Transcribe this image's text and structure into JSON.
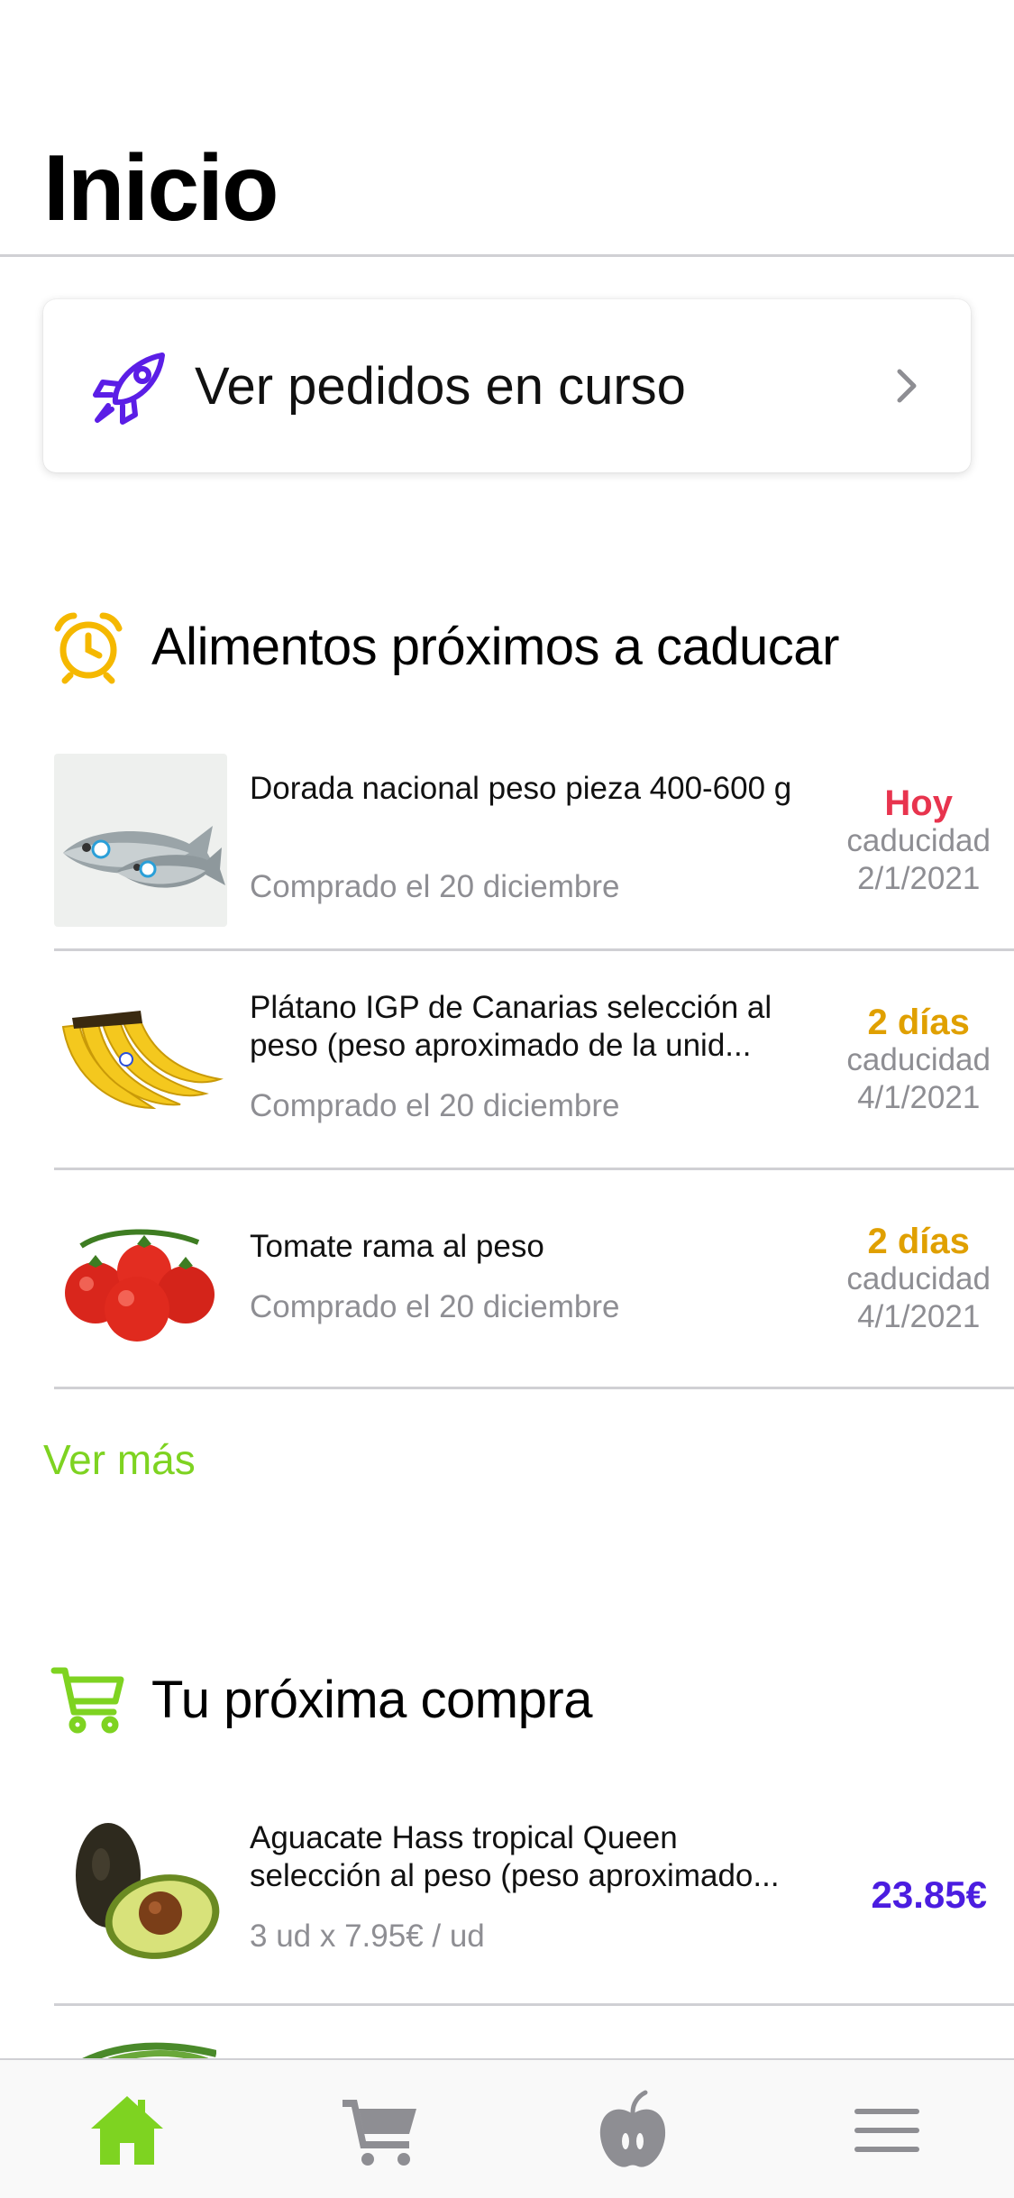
{
  "header": {
    "title": "Inicio"
  },
  "orders_card": {
    "label": "Ver pedidos en curso",
    "icon": "rocket-icon",
    "accent": "#5b1ee6"
  },
  "expiring": {
    "heading": "Alimentos próximos a caducar",
    "icon": "alarm-clock-icon",
    "items": [
      {
        "name": "Dorada nacional peso pieza 400-600 g",
        "purchased": "Comprado el 20 diciembre",
        "status": "Hoy",
        "status_color": "#e8344e",
        "expiry_label": "caducidad",
        "expiry_date": "2/1/2021"
      },
      {
        "name": "Plátano IGP de Canarias selección al peso (peso aproximado de la unid...",
        "purchased": "Comprado el 20 diciembre",
        "status": "2 días",
        "status_color": "#e0a000",
        "expiry_label": "caducidad",
        "expiry_date": "4/1/2021"
      },
      {
        "name": "Tomate rama al peso",
        "purchased": "Comprado el 20 diciembre",
        "status": "2 días",
        "status_color": "#e0a000",
        "expiry_label": "caducidad",
        "expiry_date": "4/1/2021"
      }
    ],
    "more_link": "Ver más"
  },
  "next_purchase": {
    "heading": "Tu próxima compra",
    "icon": "cart-icon",
    "items": [
      {
        "name": "Aguacate Hass tropical Queen selección al peso (peso aproximado...",
        "qty_text": "3 ud x 7.95€ / ud",
        "price": "23.85€"
      }
    ]
  },
  "tabbar": {
    "tabs": [
      {
        "icon": "home-icon",
        "active": true
      },
      {
        "icon": "cart-icon",
        "active": false
      },
      {
        "icon": "apple-icon",
        "active": false
      },
      {
        "icon": "menu-icon",
        "active": false
      }
    ],
    "active_color": "#7ed321",
    "inactive_color": "#8e8e93"
  }
}
